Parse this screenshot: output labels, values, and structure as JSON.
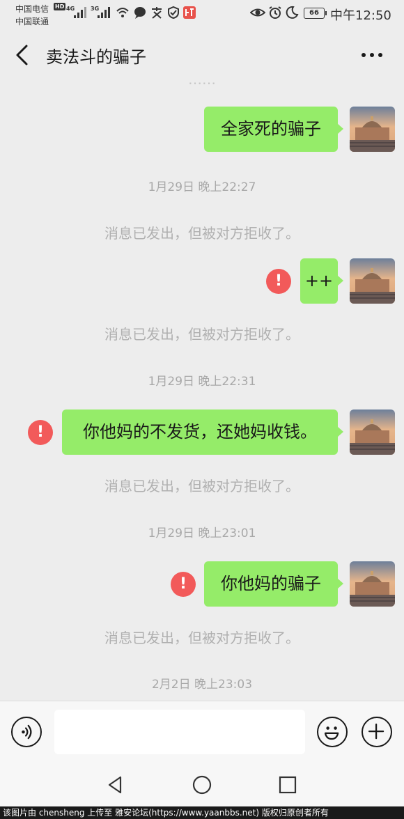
{
  "status_bar": {
    "carrier_1": "中国电信",
    "hd_badge": "HD",
    "network_1": "4G",
    "carrier_2": "中国联通",
    "network_2": "3G",
    "battery": "66",
    "time": "中午12:50"
  },
  "header": {
    "title": "卖法斗的骗子"
  },
  "chat": {
    "clipped_top_text": "……",
    "messages": [
      {
        "text": "全家死的骗子",
        "failed": false
      },
      {
        "timestamp": "1月29日 晚上22:27"
      },
      {
        "system_note": "消息已发出，但被对方拒收了。"
      },
      {
        "text": "++",
        "failed": true
      },
      {
        "system_note": "消息已发出，但被对方拒收了。"
      },
      {
        "timestamp": "1月29日 晚上22:31"
      },
      {
        "text": "你他妈的不发货，还她妈收钱。",
        "failed": true
      },
      {
        "system_note": "消息已发出，但被对方拒收了。"
      },
      {
        "timestamp": "1月29日 晚上23:01"
      },
      {
        "text": "你他妈的骗子",
        "failed": true
      },
      {
        "system_note": "消息已发出，但被对方拒收了。"
      },
      {
        "timestamp": "2月2日 晚上23:03"
      }
    ],
    "error_glyph": "!"
  },
  "input_bar": {
    "value": "",
    "placeholder": ""
  },
  "watermark": "该图片由 chensheng 上传至 雅安论坛(https://www.yaanbbs.net) 版权归原创者所有",
  "colors": {
    "background": "#ededed",
    "bubble_green": "#95ec69",
    "error_red": "#f25a5a",
    "system_text": "#b0b0b0"
  },
  "icons": {
    "back": "chevron-left-icon",
    "more": "more-dots-icon",
    "voice": "voice-icon",
    "emoji": "emoji-icon",
    "plus": "plus-icon",
    "error": "error-icon",
    "nav_back": "triangle-back-icon",
    "nav_home": "circle-home-icon",
    "nav_recent": "square-recent-icon"
  }
}
